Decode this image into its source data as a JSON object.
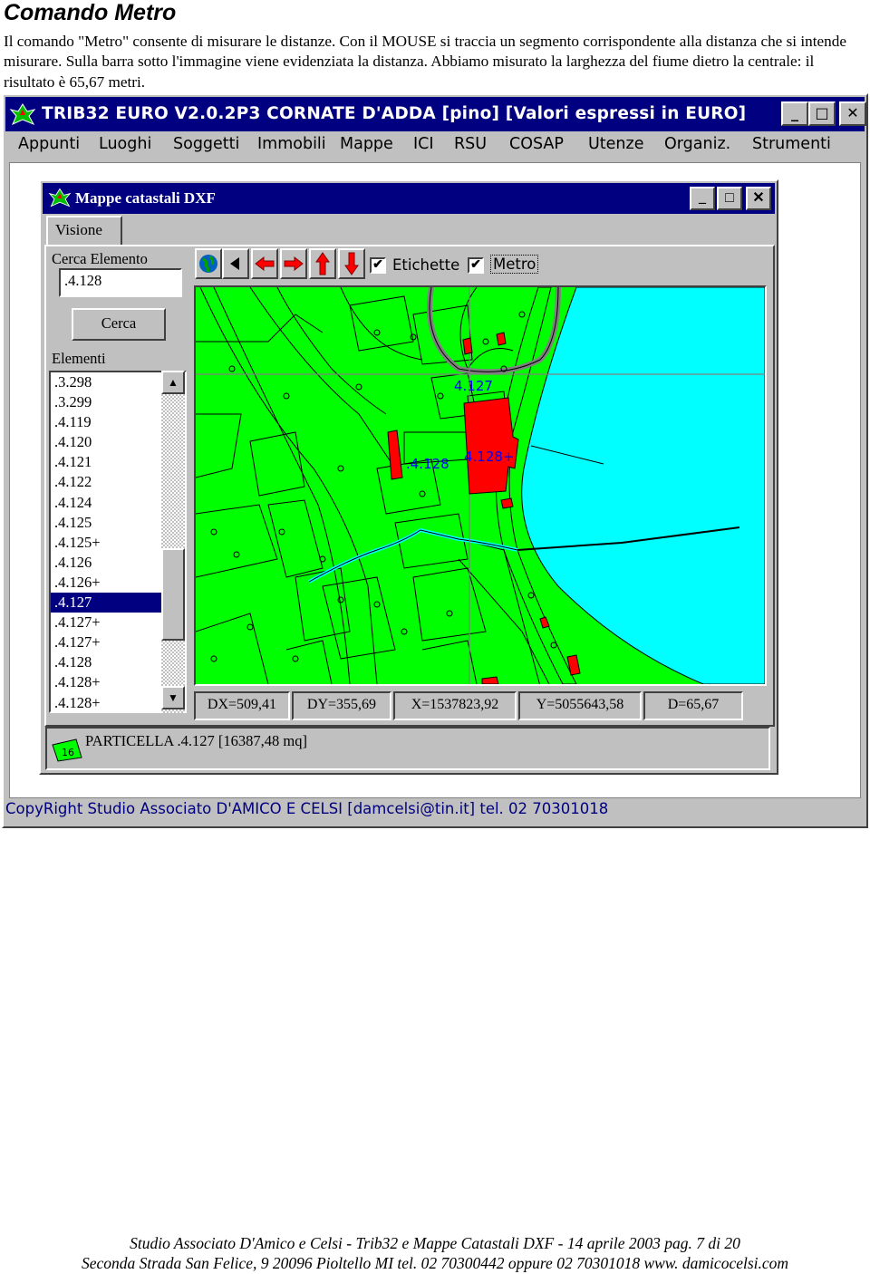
{
  "document": {
    "title": "Comando Metro",
    "paragraph": "Il comando \"Metro\" consente di misurare le distanze. Con il MOUSE si traccia un segmento corrispondente alla distanza che si intende misurare. Sulla barra sotto l'immagine viene evidenziata la distanza. Abbiamo misurato la larghezza del fiume dietro la centrale: il risultato è 65,67 metri."
  },
  "app": {
    "title": "TRIB32 EURO V2.0.2P3 CORNATE D'ADDA [pino]  [Valori espressi in EURO]",
    "menu": [
      "Appunti",
      "Luoghi",
      "Soggetti",
      "Immobili",
      "Mappe",
      "ICI",
      "RSU",
      "COSAP",
      "Utenze",
      "Organiz.",
      "Strumenti"
    ],
    "status": "CopyRight Studio Associato D'AMICO E CELSI [damcelsi@tin.it] tel. 02 70301018",
    "window_buttons": [
      "_",
      "□",
      "✕"
    ]
  },
  "child": {
    "title": "Mappe catastali DXF",
    "tab": "Visione",
    "search_label": "Cerca Elemento",
    "search_value": ".4.128",
    "search_button": "Cerca",
    "elements_label": "Elementi",
    "elements": [
      ".3.298",
      ".3.299",
      ".4.119",
      ".4.120",
      ".4.121",
      ".4.122",
      ".4.124",
      ".4.125",
      ".4.125+",
      ".4.126",
      ".4.126+",
      ".4.127",
      ".4.127+",
      ".4.127+",
      ".4.128",
      ".4.128+",
      ".4.128+"
    ],
    "selected_index": 11,
    "etichette_label": "Etichette",
    "etichette_checked": true,
    "metro_label": "Metro",
    "metro_checked": true,
    "readouts": {
      "dx": "DX=509,41",
      "dy": "DY=355,69",
      "x": "X=1537823,92",
      "y": "Y=5055643,58",
      "d": "D=65,67"
    },
    "info": "PARTICELLA .4.127 [16387,48 mq]",
    "info_icon_label": "16",
    "map_labels": {
      "a": "4.127",
      "b": ".4.128",
      "c": "4.128+"
    },
    "colors": {
      "land": "#00ff00",
      "water": "#00ffff",
      "buildings": "#ff0000",
      "label": "#0000ff"
    }
  },
  "footer": {
    "line1": "Studio Associato D'Amico e Celsi - Trib32 e Mappe Catastali DXF - 14 aprile 2003 pag. 7 di 20",
    "line2": "Seconda Strada San Felice, 9 20096 Pioltello MI tel. 02 70300442 oppure 02 70301018  www. damicocelsi.com"
  }
}
